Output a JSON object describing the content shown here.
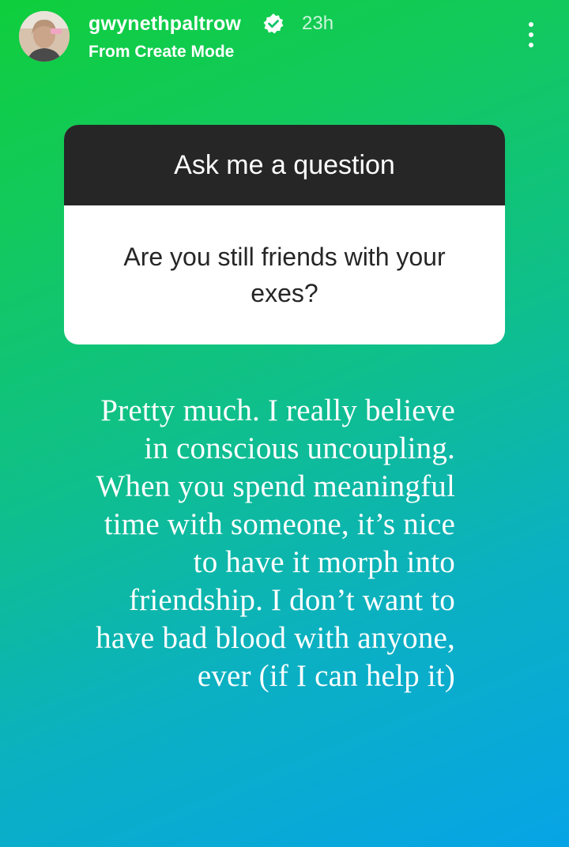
{
  "header": {
    "username": "gwynethpaltrow",
    "verified_icon": "verified-badge-icon",
    "timestamp": "23h",
    "subtitle": "From Create Mode",
    "more_icon": "more-vertical-icon"
  },
  "question_sticker": {
    "title": "Ask me a question",
    "question": "Are you still friends with your exes?"
  },
  "answer_text": "Pretty much. I really believe in conscious uncoupling. When you spend meaningful time with someone, it’s nice to have it morph into friendship. I don’t want to have bad blood with anyone, ever (if I can help it)",
  "colors": {
    "gradient_top": "#0fce3c",
    "gradient_bottom": "#07a4e6",
    "sticker_header": "#262626",
    "sticker_body": "#ffffff"
  }
}
